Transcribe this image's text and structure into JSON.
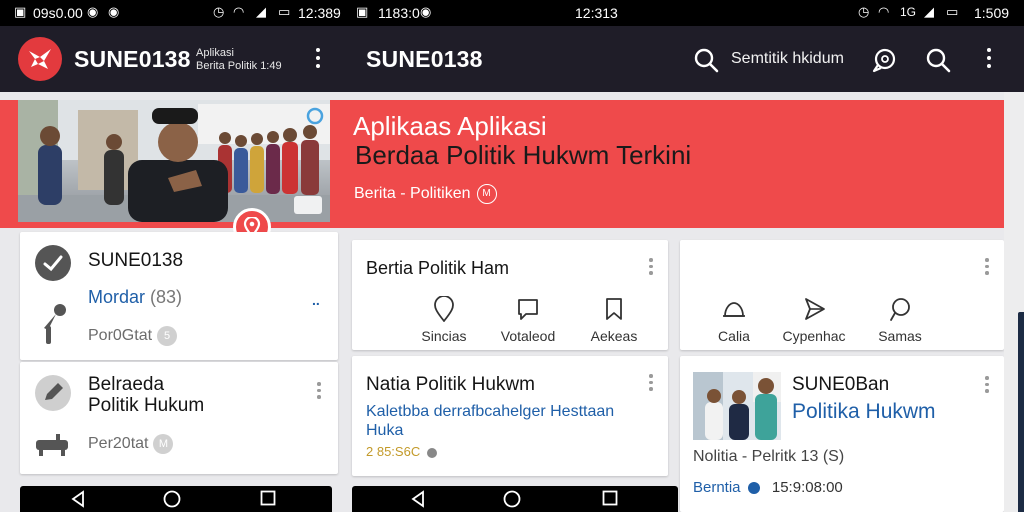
{
  "status_bar": {
    "left_text": "09s0.00",
    "mid_text_1": "1183:0",
    "mid_text_2": "12:313",
    "right_text_1": "12:389",
    "right_text_2": "1:509",
    "right_small": "1G"
  },
  "app_bar": {
    "title_left": "SUNE0138",
    "subtitle_line1": "Aplikasi",
    "subtitle_line2": "Berita Politik 1:49",
    "title_mid": "SUNE0138",
    "search_label": "Semtitik hkidum"
  },
  "hero": {
    "headline_top": "Aplikaas  Aplikasi",
    "headline_main": "Berdaa Politik Hukwm Terkini",
    "meta_text": "Berita - Politiken",
    "meta_badge": "M"
  },
  "left_cards": [
    {
      "title": "SUNE0138",
      "subtitle": "Mordar",
      "subtitle_badge": "(83)",
      "meta": "Por0Gtat",
      "meta_badge": "5",
      "extra": ".."
    },
    {
      "title_line1": "Belraeda",
      "title_line2": "Politik Hukum",
      "meta": "Per20tat",
      "meta_badge": "M"
    }
  ],
  "mid_cards": [
    {
      "title": "Bertia Politik Ham",
      "actions": [
        {
          "label": "Sincias",
          "icon": "pin-icon"
        },
        {
          "label": "Votaleod",
          "icon": "chat-icon"
        },
        {
          "label": "Aekeas",
          "icon": "bookmark-icon"
        }
      ]
    },
    {
      "title": "Natia Politik Hukwm",
      "excerpt_line1": "Kaletbba derrafbcahelger Hesttaan",
      "excerpt_line2": "Huka",
      "meta": "2 85:S6C"
    }
  ],
  "right_cards": [
    {
      "actions": [
        {
          "label": "Calia",
          "icon": "cloud-icon"
        },
        {
          "label": "Cypenhac",
          "icon": "send-icon"
        },
        {
          "label": "Samas",
          "icon": "comment-icon"
        }
      ]
    },
    {
      "title": "SUNE0Ban",
      "subtitle": "Politika Hukwm",
      "meta": "Nolitia - Pelritk 13 (S)",
      "footer_label": "Berntia",
      "footer_time": "15:9:08:00"
    }
  ],
  "colors": {
    "accent_red": "#ef4a4b",
    "app_bar": "#1f1d28",
    "link_blue": "#1f5fa8"
  }
}
